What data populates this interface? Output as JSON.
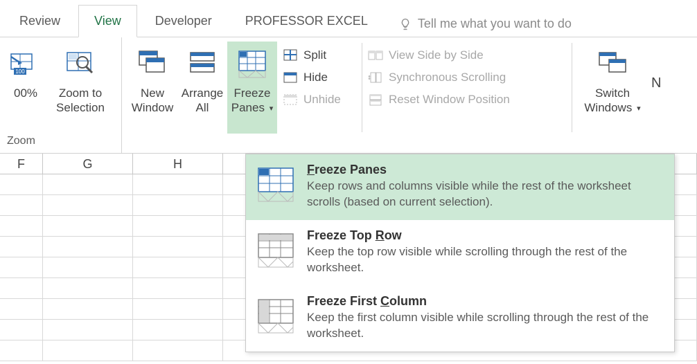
{
  "tabs": {
    "review": "Review",
    "view": "View",
    "developer": "Developer",
    "profexcel": "PROFESSOR EXCEL",
    "tellme": "Tell me what you want to do"
  },
  "ribbon": {
    "zoom": {
      "pct": "00%",
      "zoom_to": "Zoom to",
      "selection": "Selection",
      "group_label": "Zoom"
    },
    "window": {
      "new_window_1": "New",
      "new_window_2": "Window",
      "arrange_1": "Arrange",
      "arrange_2": "All",
      "freeze_1": "Freeze",
      "freeze_2": "Panes",
      "split": "Split",
      "hide": "Hide",
      "unhide": "Unhide",
      "side_by_side": "View Side by Side",
      "sync_scroll": "Synchronous Scrolling",
      "reset_pos": "Reset Window Position",
      "switch_1": "Switch",
      "switch_2": "Windows"
    }
  },
  "col_headers": [
    "F",
    "G",
    "H"
  ],
  "menu": {
    "item1": {
      "title_pre": "",
      "title_key": "F",
      "title_post": "reeze Panes",
      "desc": "Keep rows and columns visible while the rest of the worksheet scrolls (based on current selection)."
    },
    "item2": {
      "title_pre": "Freeze Top ",
      "title_key": "R",
      "title_post": "ow",
      "desc": "Keep the top row visible while scrolling through the rest of the worksheet."
    },
    "item3": {
      "title_pre": "Freeze First ",
      "title_key": "C",
      "title_post": "olumn",
      "desc": "Keep the first column visible while scrolling through the rest of the worksheet."
    }
  }
}
